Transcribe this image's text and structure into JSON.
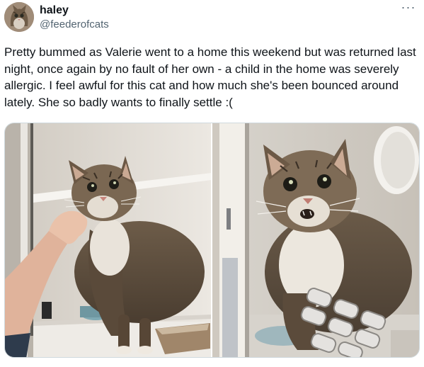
{
  "author": {
    "display_name": "haley",
    "handle": "@feederofcats"
  },
  "more_menu": {
    "icon": "more-horizontal-icon",
    "glyph": "···"
  },
  "tweet": {
    "text": "Pretty bummed as Valerie went to a home this weekend but was returned last night, once again by no fault of her own - a child in the home was severely allergic. I feel awful for this cat and how much she's been bounced around lately. She so badly wants to finally settle :("
  },
  "colors": {
    "text": "#0f1419",
    "secondary": "#536471",
    "border": "#cfd9de"
  }
}
